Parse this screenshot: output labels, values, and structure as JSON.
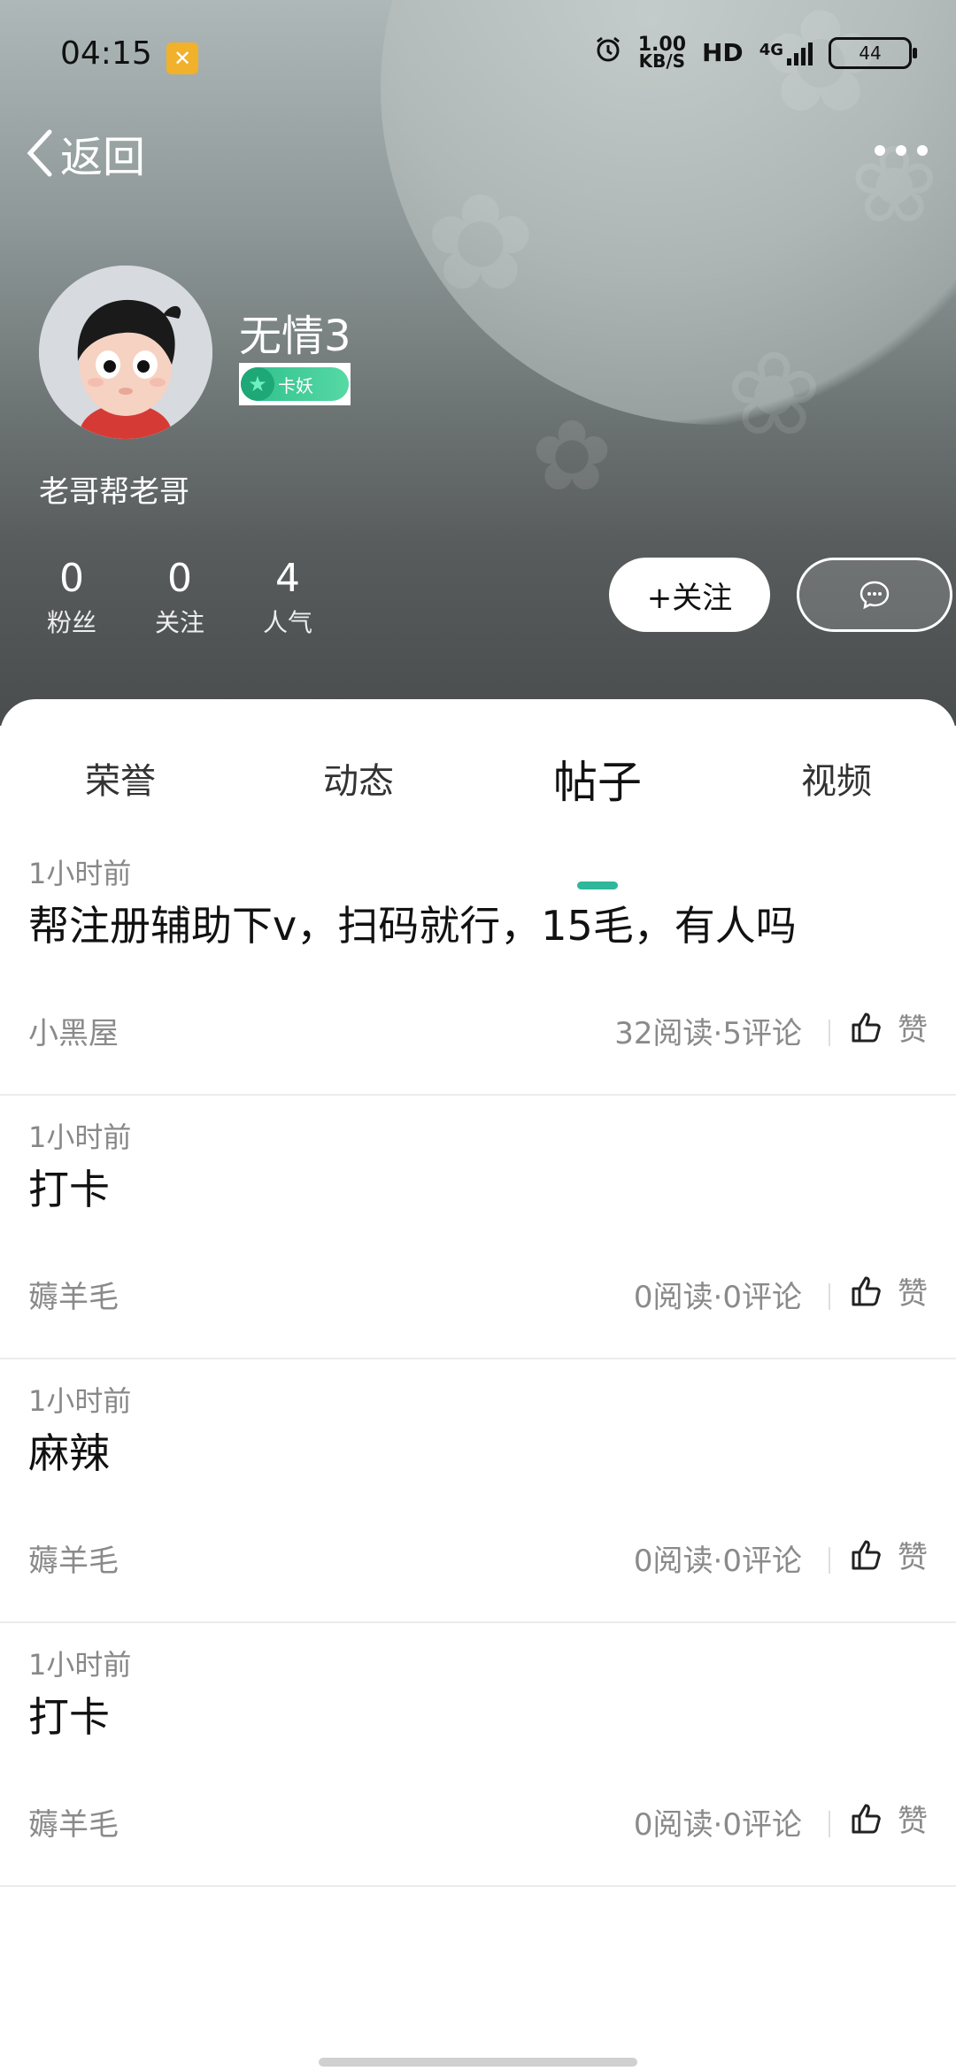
{
  "status_bar": {
    "time": "04:15",
    "speed_value": "1.00",
    "speed_unit": "KB/S",
    "hd_label": "HD",
    "network": "4G",
    "battery": "44"
  },
  "nav": {
    "back_label": "返回"
  },
  "profile": {
    "username": "无情3",
    "badge_label": "卡妖",
    "bio": "老哥帮老哥",
    "stats": [
      {
        "value": "0",
        "label": "粉丝"
      },
      {
        "value": "0",
        "label": "关注"
      },
      {
        "value": "4",
        "label": "人气"
      }
    ],
    "follow_label": "+关注"
  },
  "tabs": [
    "荣誉",
    "动态",
    "帖子",
    "视频"
  ],
  "active_tab": "帖子",
  "posts": [
    {
      "time": "1小时前",
      "title": "帮注册辅助下v，扫码就行，15毛，有人吗",
      "category": "小黑屋",
      "meta": "32阅读·5评论",
      "like_label": "赞"
    },
    {
      "time": "1小时前",
      "title": "打卡",
      "category": "薅羊毛",
      "meta": "0阅读·0评论",
      "like_label": "赞"
    },
    {
      "time": "1小时前",
      "title": "麻辣",
      "category": "薅羊毛",
      "meta": "0阅读·0评论",
      "like_label": "赞"
    },
    {
      "time": "1小时前",
      "title": "打卡",
      "category": "薅羊毛",
      "meta": "0阅读·0评论",
      "like_label": "赞"
    }
  ],
  "colors": {
    "accent": "#2eb79a",
    "badge_green": "#3ecf96"
  }
}
